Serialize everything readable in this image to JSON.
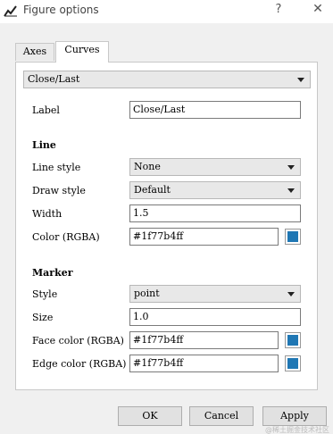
{
  "window": {
    "title": "Figure options",
    "help_glyph": "?",
    "close_glyph": "✕"
  },
  "tabs": [
    {
      "label": "Axes"
    },
    {
      "label": "Curves"
    }
  ],
  "curve_select": {
    "value": "Close/Last"
  },
  "label_row": {
    "label": "Label",
    "value": "Close/Last"
  },
  "line_section": {
    "heading": "Line",
    "style": {
      "label": "Line style",
      "value": "None"
    },
    "draw_style": {
      "label": "Draw style",
      "value": "Default"
    },
    "width": {
      "label": "Width",
      "value": "1.5"
    },
    "color": {
      "label": "Color (RGBA)",
      "value": "#1f77b4ff"
    }
  },
  "marker_section": {
    "heading": "Marker",
    "style": {
      "label": "Style",
      "value": "point"
    },
    "size": {
      "label": "Size",
      "value": "1.0"
    },
    "face_color": {
      "label": "Face color (RGBA)",
      "value": "#1f77b4ff"
    },
    "edge_color": {
      "label": "Edge color (RGBA)",
      "value": "#1f77b4ff"
    }
  },
  "swatch_color": "#1f77b4",
  "buttons": {
    "ok": "OK",
    "cancel": "Cancel",
    "apply": "Apply"
  },
  "watermark": "@稀土掘金技术社区"
}
